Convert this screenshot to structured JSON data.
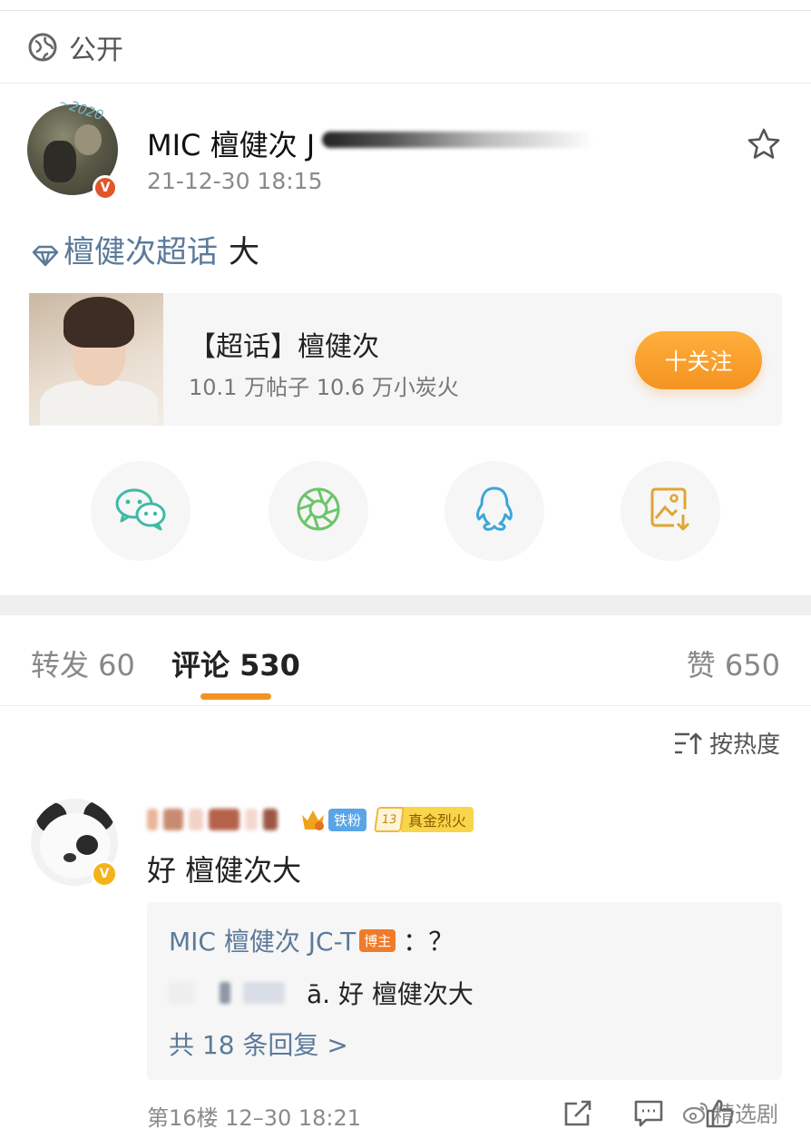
{
  "visibility": {
    "icon": "globe-icon",
    "label": "公开"
  },
  "post": {
    "author_name": "MIC 檀健次 J",
    "time": "21-12-30 18:15",
    "avatar_deco_text": "~2020",
    "topic_name": "檀健次超话",
    "topic_suffix": "大"
  },
  "super_topic_card": {
    "title": "【超话】檀健次",
    "stats": "10.1 万帖子 10.6 万小炭火",
    "follow_label": "十关注"
  },
  "share": {
    "items": [
      "wechat-icon",
      "moments-icon",
      "qq-icon",
      "save-image-icon"
    ]
  },
  "tabs": {
    "repost": "转发 60",
    "comments": "评论 530",
    "likes": "赞 650"
  },
  "sort_label": "按热度",
  "comment": {
    "fan_badge": "铁粉",
    "level_number": "13",
    "level_title": "真金烈火",
    "text": "好 檀健次大",
    "reply": {
      "author": "MIC 檀健次 JC-T",
      "author_badge": "博主",
      "text": "：？",
      "quoted_text": "ā. 好 檀健次大",
      "more_label": "共 18 条回复 >"
    },
    "meta": "第16楼 12–30 18:21"
  },
  "watermark": "精选剧",
  "colors": {
    "accent_orange": "#f49321",
    "link_blue": "#5b7a9a",
    "verified_red": "#e2552a",
    "verified_gold": "#f5b21a"
  }
}
